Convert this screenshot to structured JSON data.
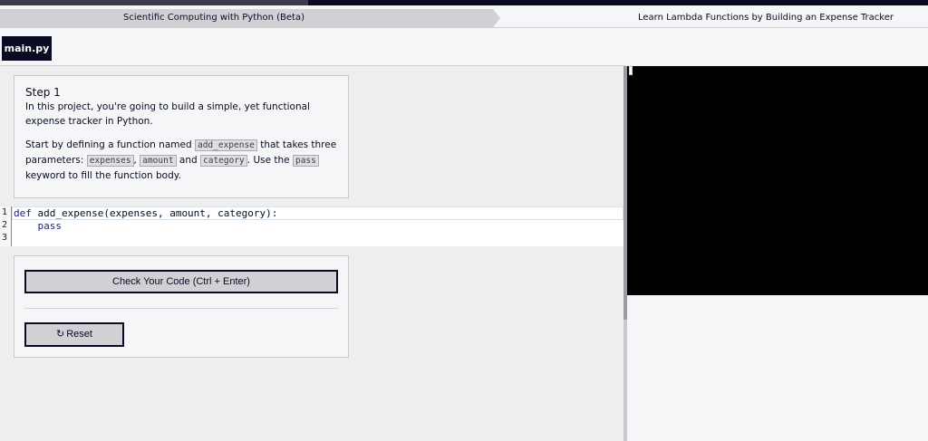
{
  "breadcrumb": {
    "course": "Scientific Computing with Python (Beta)",
    "project": "Learn Lambda Functions by Building an Expense Tracker"
  },
  "file_tab": {
    "label": "main.py"
  },
  "instructions": {
    "step": "Step 1",
    "p1": "In this project, you're going to build a simple, yet functional expense tracker in Python.",
    "p2_a": "Start by defining a function named ",
    "p2_code_fn": "add_expense",
    "p2_b": " that takes three parameters: ",
    "p2_code_1": "expenses",
    "p2_sep": ", ",
    "p2_code_2": "amount",
    "p2_and": " and ",
    "p2_code_3": "category",
    "p2_c": ". Use the ",
    "p2_code_pass": "pass",
    "p2_d": " keyword to fill the function body."
  },
  "editor": {
    "line_numbers": [
      "1",
      "2",
      "3"
    ],
    "line1_kw": "def",
    "line1_rest": " add_expense(expenses, amount, category):",
    "line2": "    pass",
    "line3": ""
  },
  "actions": {
    "check_label": "Check Your Code (Ctrl + Enter)",
    "reset_label": "Reset",
    "reset_icon": "refresh-icon"
  },
  "colors": {
    "nav": "#0a0a23",
    "button_bg": "#d0d0d5",
    "preview_bg": "#000000"
  }
}
